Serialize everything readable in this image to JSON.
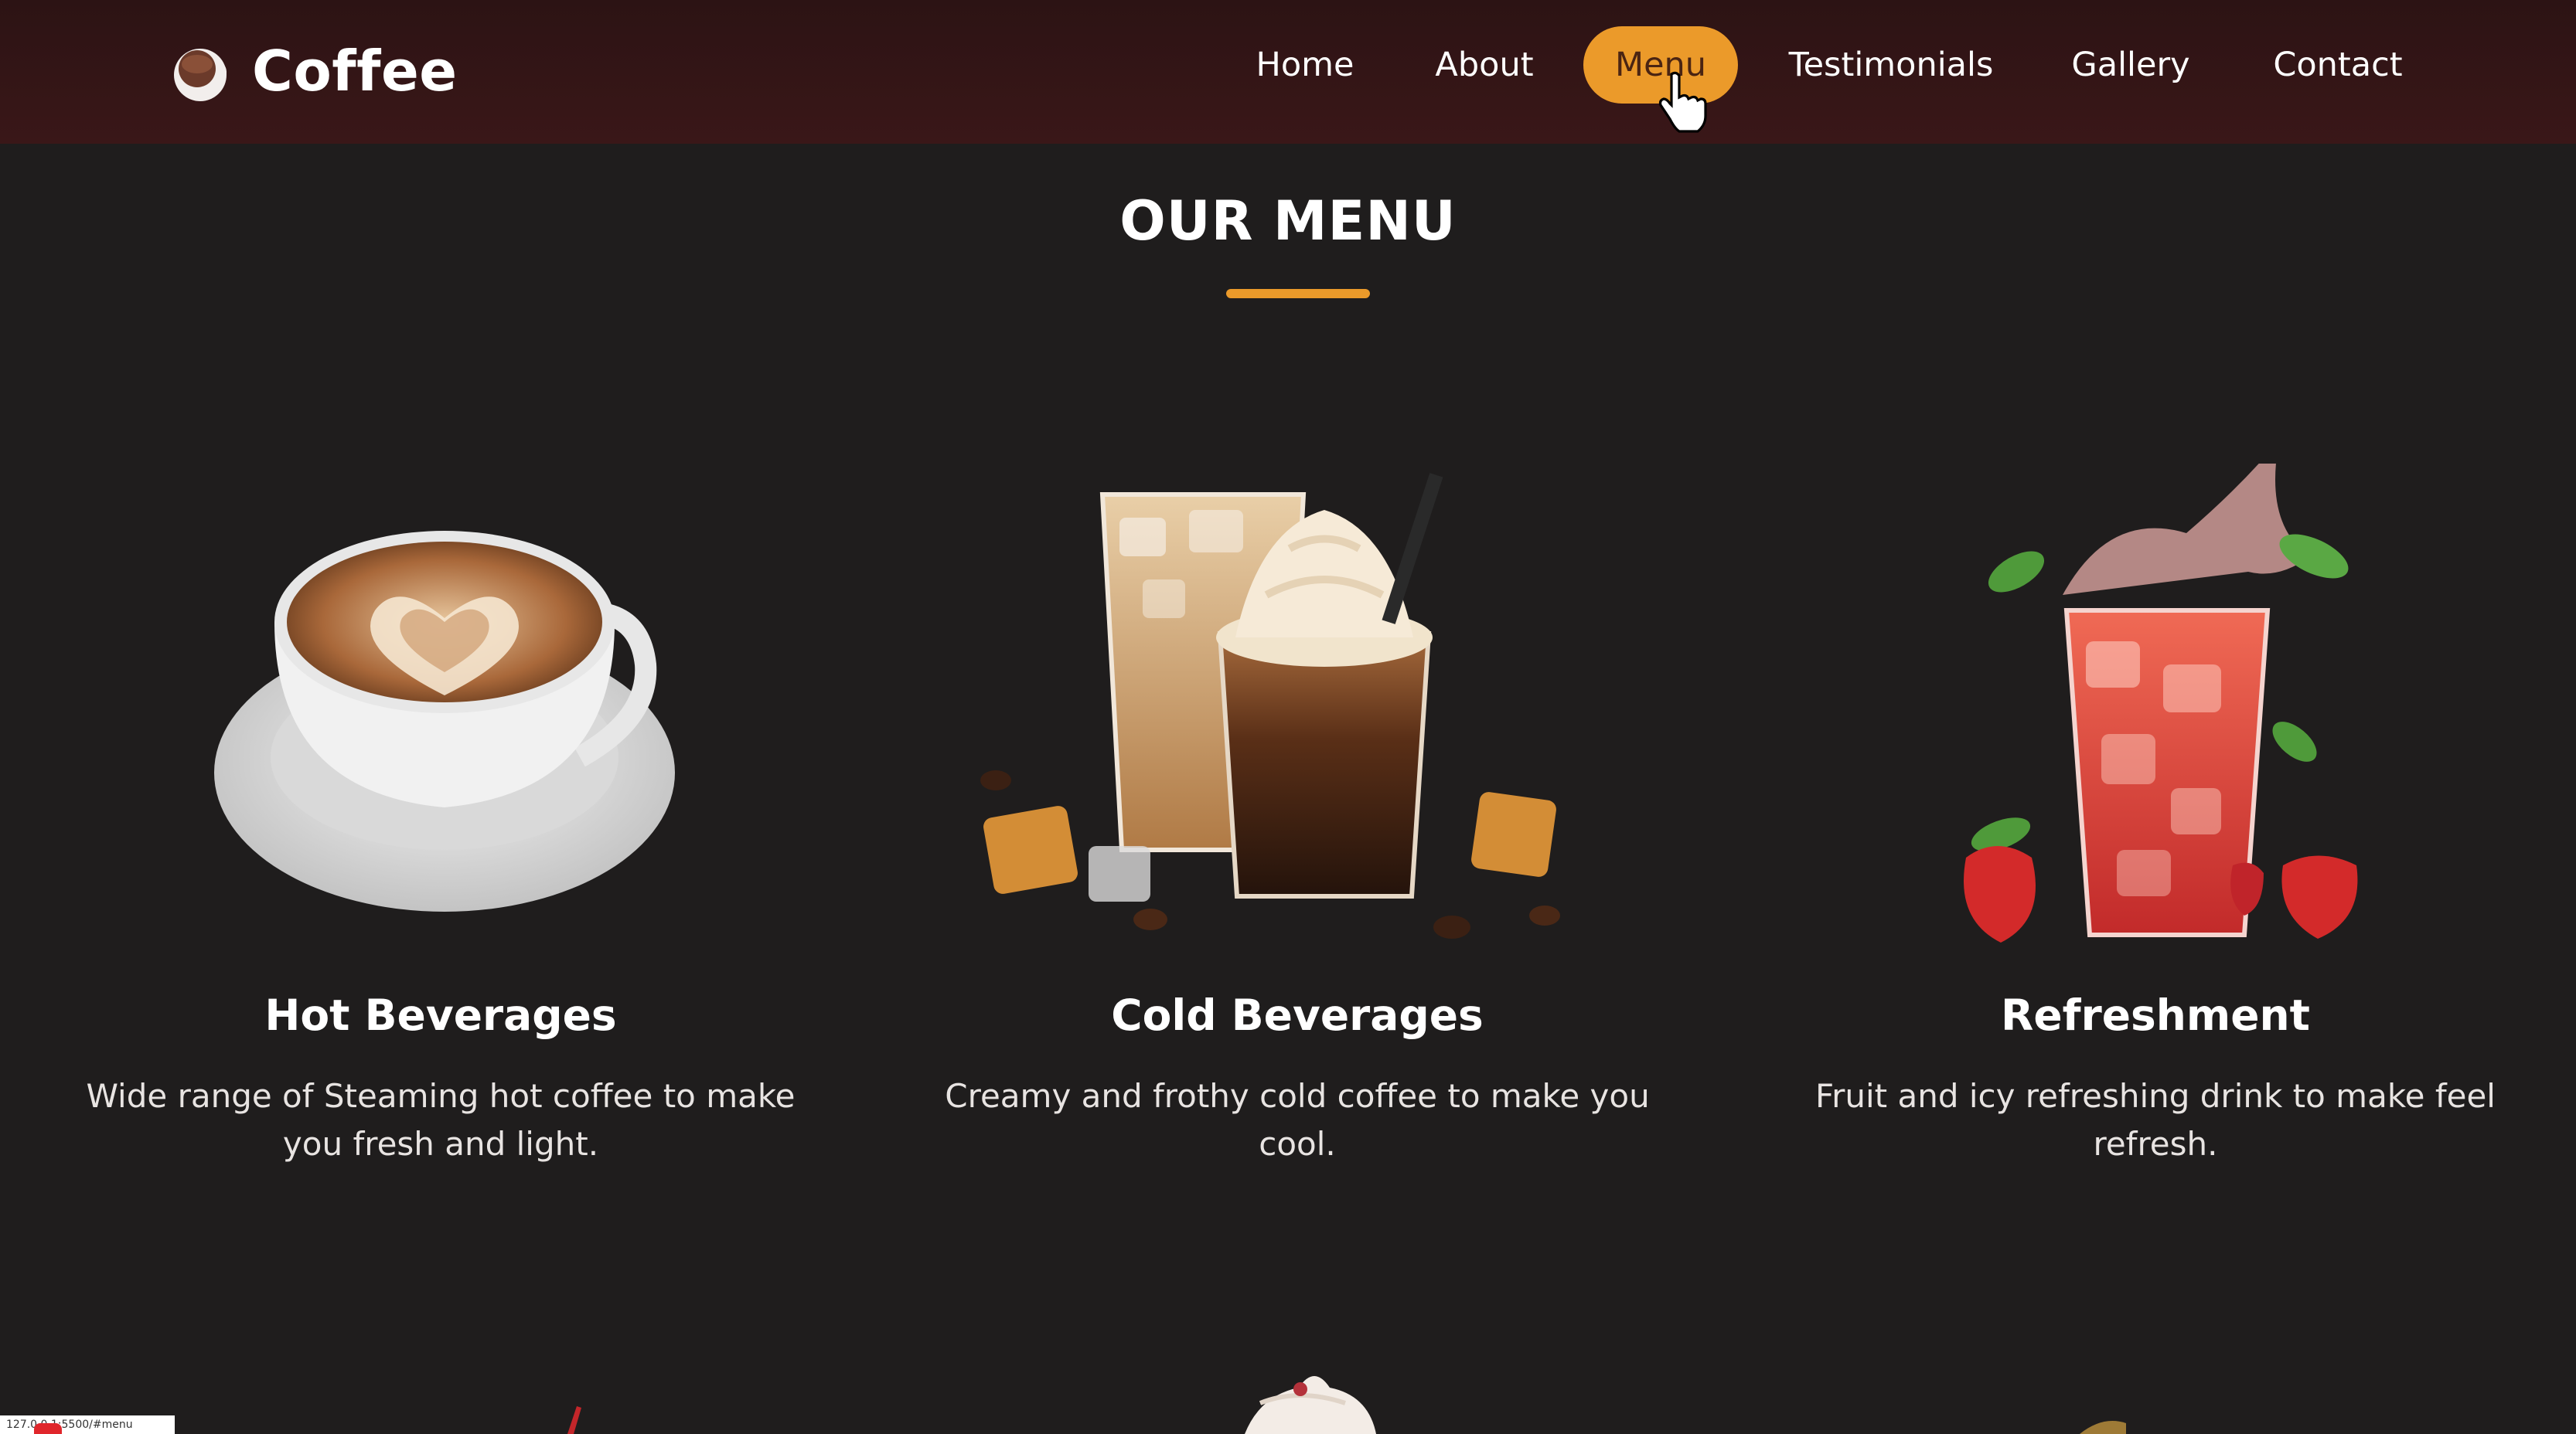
{
  "brand": {
    "name": "Coffee",
    "logo_icon": "coffee-cup-icon"
  },
  "nav": {
    "items": [
      {
        "label": "Home",
        "active": false
      },
      {
        "label": "About",
        "active": false
      },
      {
        "label": "Menu",
        "active": true
      },
      {
        "label": "Testimonials",
        "active": false
      },
      {
        "label": "Gallery",
        "active": false
      },
      {
        "label": "Contact",
        "active": false
      }
    ]
  },
  "menu_section": {
    "title": "OUR MENU",
    "cards": [
      {
        "title": "Hot Beverages",
        "description": "Wide range of Steaming hot coffee to make you fresh and light.",
        "image": "latte-art-cup-image"
      },
      {
        "title": "Cold Beverages",
        "description": "Creamy and frothy cold coffee to make you cool.",
        "image": "iced-coffee-glasses-image"
      },
      {
        "title": "Refreshment",
        "description": "Fruit and icy refreshing drink to make feel refresh.",
        "image": "strawberry-iced-drink-image"
      }
    ]
  },
  "status_bar": {
    "url_text": "127.0.0.1:5500/#menu"
  },
  "colors": {
    "accent": "#eb9a2a",
    "navbar": "#3a1718",
    "background": "#1f1d1d",
    "text": "#ffffff"
  }
}
